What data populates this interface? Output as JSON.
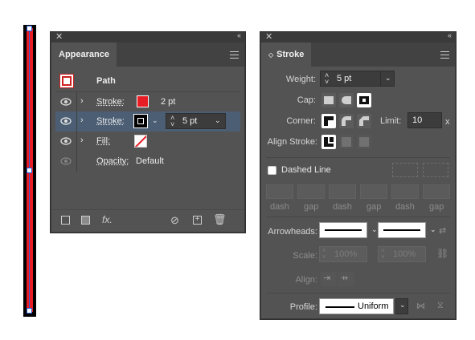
{
  "appearance": {
    "tab_label": "Appearance",
    "path_label": "Path",
    "rows": [
      {
        "label": "Stroke:",
        "value": "2 pt"
      },
      {
        "label": "Stroke:",
        "value": "5 pt"
      },
      {
        "label": "Fill:"
      },
      {
        "label": "Opacity:",
        "value": "Default"
      }
    ],
    "fx_label": "fx."
  },
  "stroke_panel": {
    "tab_label": "Stroke",
    "weight_label": "Weight:",
    "weight_value": "5 pt",
    "cap_label": "Cap:",
    "corner_label": "Corner:",
    "limit_label": "Limit:",
    "limit_value": "10",
    "limit_unit": "x",
    "align_label": "Align Stroke:",
    "dashed_label": "Dashed Line",
    "dash_labels": [
      "dash",
      "gap",
      "dash",
      "gap",
      "dash",
      "gap"
    ],
    "arrowheads_label": "Arrowheads:",
    "scale_label": "Scale:",
    "scale_value_1": "100%",
    "scale_value_2": "100%",
    "align2_label": "Align:",
    "profile_label": "Profile:",
    "profile_value": "Uniform"
  },
  "colors": {
    "stroke_red": "#e81c24",
    "selection_row": "#4b5e74",
    "panel_bg": "#535353"
  }
}
